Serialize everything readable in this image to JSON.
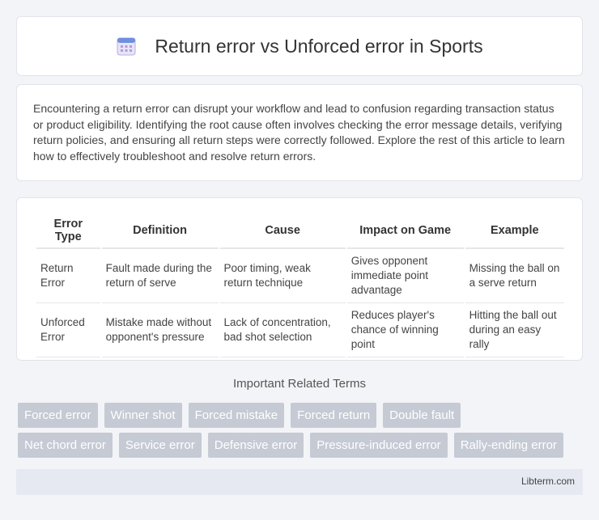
{
  "header": {
    "title": "Return error vs Unforced error in Sports",
    "icon": "calendar-icon"
  },
  "intro": "Encountering a return error can disrupt your workflow and lead to confusion regarding transaction status or product eligibility. Identifying the root cause often involves checking the error message details, verifying return policies, and ensuring all return steps were correctly followed. Explore the rest of this article to learn how to effectively troubleshoot and resolve return errors.",
  "table": {
    "headers": [
      "Error Type",
      "Definition",
      "Cause",
      "Impact on Game",
      "Example"
    ],
    "rows": [
      [
        "Return Error",
        "Fault made during the return of serve",
        "Poor timing, weak return technique",
        "Gives opponent immediate point advantage",
        "Missing the ball on a serve return"
      ],
      [
        "Unforced Error",
        "Mistake made without opponent's pressure",
        "Lack of concentration, bad shot selection",
        "Reduces player's chance of winning point",
        "Hitting the ball out during an easy rally"
      ]
    ]
  },
  "related": {
    "title": "Important Related Terms",
    "row1": [
      "Forced error",
      "Winner shot",
      "Forced mistake",
      "Forced return",
      "Double fault"
    ],
    "row2": [
      "Net chord error",
      "Service error",
      "Defensive error",
      "Pressure-induced error",
      "Rally-ending error"
    ]
  },
  "footer": {
    "text": "Libterm.com"
  },
  "colors": {
    "tag_bg": "#c5cad4",
    "page_bg": "#f3f4f7",
    "footer_bg": "#e6e9f2"
  }
}
